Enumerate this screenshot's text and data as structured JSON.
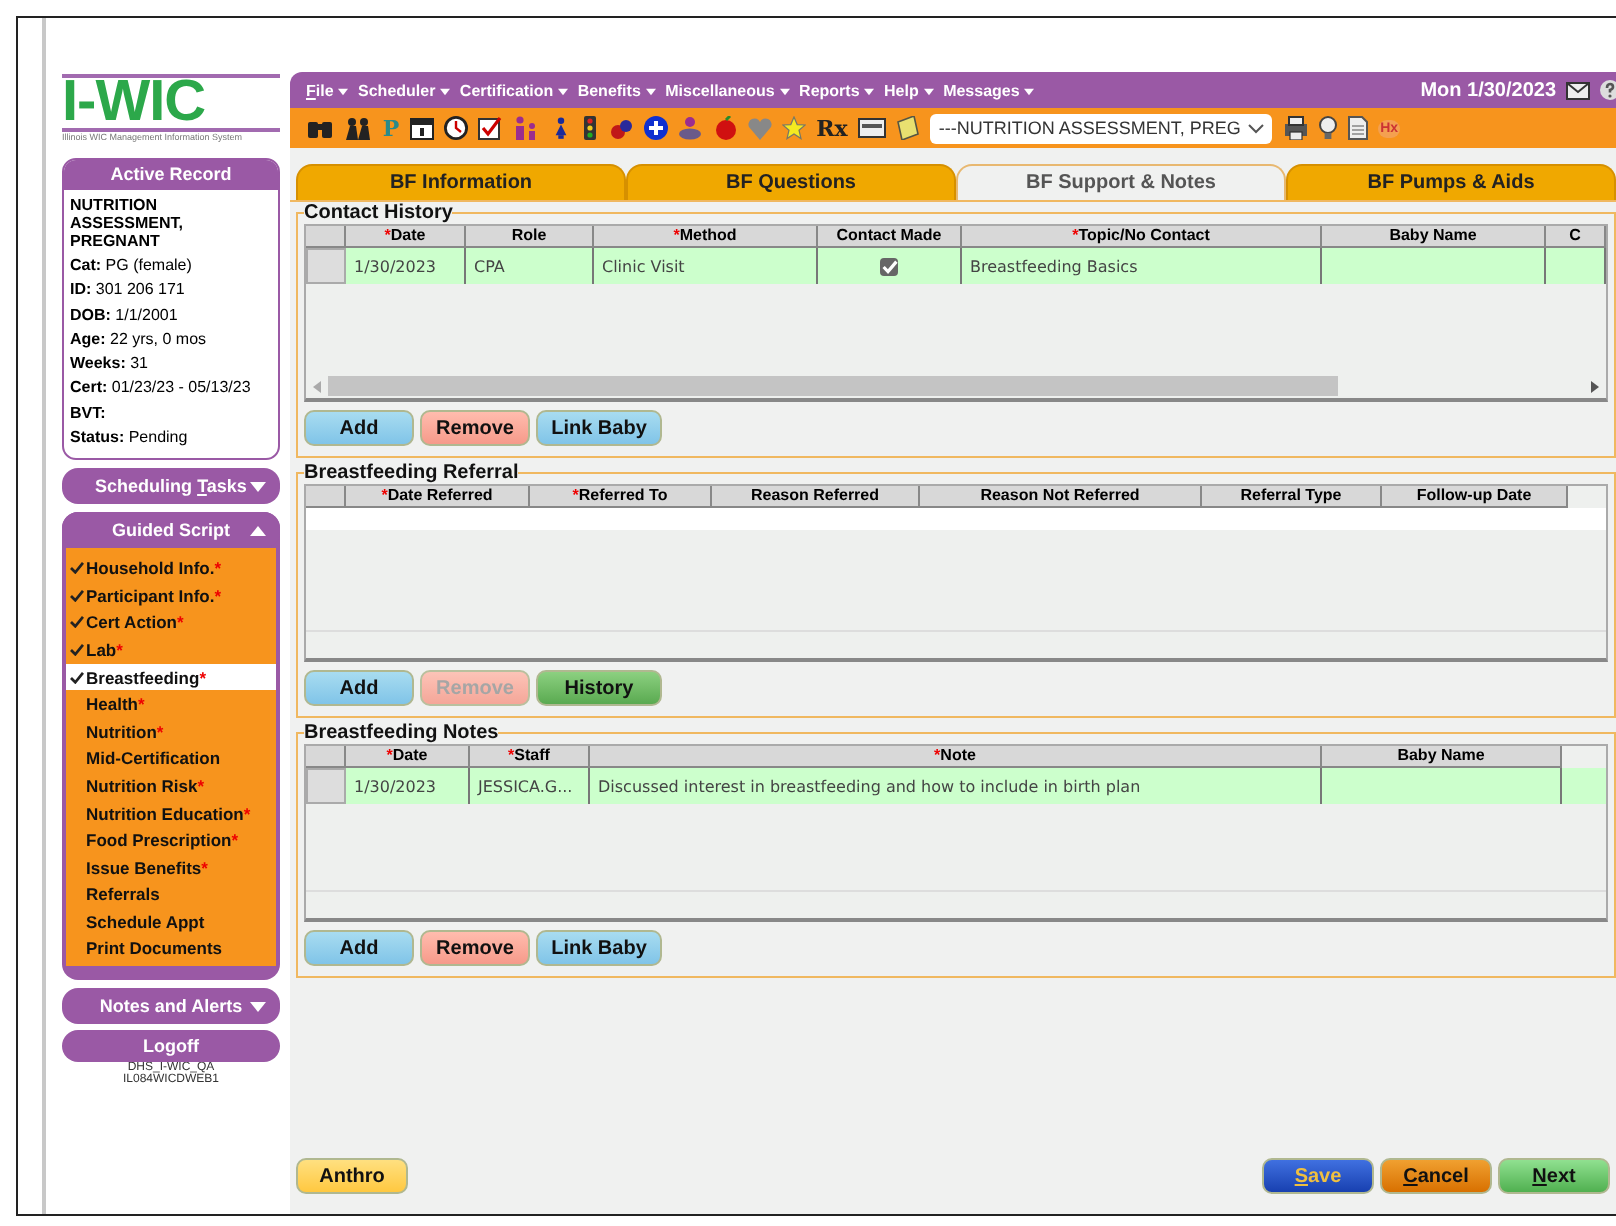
{
  "logo": {
    "title": "I-WIC",
    "subtitle": "Illinois WIC Management Information System"
  },
  "active_record": {
    "title": "Active Record",
    "heading": "NUTRITION ASSESSMENT, PREGNANT",
    "fields": [
      {
        "label": "Cat:",
        "value": "PG (female)"
      },
      {
        "label": "ID:",
        "value": "301 206 171"
      },
      {
        "label": "DOB:",
        "value": "1/1/2001"
      },
      {
        "label": "Age:",
        "value": "22 yrs, 0 mos"
      },
      {
        "label": "Weeks:",
        "value": "31"
      },
      {
        "label": "Cert:",
        "value": "01/23/23 - 05/13/23"
      },
      {
        "label": "BVT:"
      },
      {
        "label": "Status:",
        "value": "Pending"
      }
    ]
  },
  "scheduling_tasks": {
    "pre": "Scheduling ",
    "hot": "T",
    "rest": "asks",
    "expanded": false
  },
  "guided_script": {
    "title": "Guided Script",
    "expanded": true,
    "items": [
      {
        "label": "Household Info.",
        "done": true,
        "req": "*",
        "selected": false
      },
      {
        "label": "Participant Info.",
        "done": true,
        "req": "*",
        "selected": false
      },
      {
        "label": "Cert Action",
        "done": true,
        "req": "*",
        "selected": false
      },
      {
        "label": "Lab",
        "done": true,
        "req": "*",
        "selected": false
      },
      {
        "label": "Breastfeeding",
        "done": true,
        "req": "*",
        "selected": true
      },
      {
        "label": "Health",
        "done": false,
        "req": "*",
        "selected": false
      },
      {
        "label": "Nutrition",
        "done": false,
        "req": "*",
        "selected": false
      },
      {
        "label": "Mid-Certification",
        "done": false,
        "selected": false
      },
      {
        "label": "Nutrition Risk",
        "done": false,
        "req": "*",
        "selected": false
      },
      {
        "label": "Nutrition Education",
        "done": false,
        "req": "*",
        "selected": false
      },
      {
        "label": "Food Prescription",
        "done": false,
        "req": "*",
        "selected": false
      },
      {
        "label": "Issue Benefits",
        "done": false,
        "req": "*",
        "selected": false
      },
      {
        "label": "Referrals",
        "done": false,
        "selected": false
      },
      {
        "label": "Schedule Appt",
        "done": false,
        "selected": false
      },
      {
        "label": "Print Documents",
        "done": false,
        "selected": false
      }
    ]
  },
  "notes_and_alerts": {
    "title": "Notes and Alerts",
    "expanded": false
  },
  "logoff": "Logoff",
  "server": [
    "DHS_I-WIC_QA",
    "IL084WICDWEB1"
  ],
  "menu": [
    {
      "hot": "F",
      "rest": "ile"
    },
    {
      "rest": "Scheduler"
    },
    {
      "rest": "Certification"
    },
    {
      "rest": "Benefits"
    },
    {
      "rest": "Miscellaneous"
    },
    {
      "rest": "Reports"
    },
    {
      "rest": "Help"
    },
    {
      "rest": "Messages"
    }
  ],
  "date": "Mon 1/30/2023",
  "toolbar": [
    {
      "kind": "binoculars"
    },
    {
      "kind": "people"
    },
    {
      "kind": "letter",
      "text": "P"
    },
    {
      "kind": "calendar"
    },
    {
      "kind": "clock"
    },
    {
      "kind": "checkbox"
    },
    {
      "kind": "family"
    },
    {
      "kind": "woman"
    },
    {
      "kind": "traffic"
    },
    {
      "kind": "drops"
    },
    {
      "kind": "plus"
    },
    {
      "kind": "baby"
    },
    {
      "kind": "apple"
    },
    {
      "kind": "heart"
    },
    {
      "kind": "star"
    },
    {
      "kind": "letter",
      "text": "Rx"
    },
    {
      "kind": "card"
    },
    {
      "kind": "note"
    }
  ],
  "record_select": "---NUTRITION ASSESSMENT, PREG",
  "toolbar_right": [
    {
      "kind": "printer"
    },
    {
      "kind": "bulb"
    },
    {
      "kind": "document"
    },
    {
      "kind": "badge",
      "text": "Hx"
    }
  ],
  "tabs": [
    {
      "label": "BF Information",
      "selected": false
    },
    {
      "label": "BF Questions",
      "selected": false
    },
    {
      "label": "BF Support & Notes",
      "selected": true
    },
    {
      "label": "BF Pumps & Aids",
      "selected": false
    }
  ],
  "sections": [
    {
      "title": "Contact History",
      "scrollbar": true,
      "columns": [
        {
          "label": "Date",
          "req": "*"
        },
        {
          "label": "Role"
        },
        {
          "label": "Method",
          "req": "*"
        },
        {
          "label": "Contact Made"
        },
        {
          "label": "Topic/No Contact",
          "req": "*"
        },
        {
          "label": "Baby Name"
        },
        {
          "label": "C"
        }
      ],
      "rows": [
        {
          "cells": [
            {
              "kind": "text",
              "text": "1/30/2023"
            },
            {
              "kind": "text",
              "text": "CPA"
            },
            {
              "kind": "text",
              "text": "Clinic Visit"
            },
            {
              "kind": "check",
              "checked": true
            },
            {
              "kind": "text",
              "text": "Breastfeeding Basics"
            },
            {
              "kind": "blank"
            },
            {
              "kind": "blank"
            }
          ]
        }
      ],
      "buttons": [
        {
          "label": "Add",
          "kind": "blue",
          "disabled": false
        },
        {
          "label": "Remove",
          "kind": "red",
          "disabled": false
        },
        {
          "label": "Link Baby",
          "kind": "blue",
          "disabled": false
        }
      ]
    },
    {
      "title": "Breastfeeding Referral",
      "scrollbar": false,
      "columns": [
        {
          "label": "Date Referred",
          "req": "*"
        },
        {
          "label": "Referred To",
          "req": "*"
        },
        {
          "label": "Reason Referred"
        },
        {
          "label": "Reason Not Referred"
        },
        {
          "label": "Referral Type"
        },
        {
          "label": "Follow-up Date"
        }
      ],
      "buttons": [
        {
          "label": "Add",
          "kind": "blue",
          "disabled": false
        },
        {
          "label": "Remove",
          "kind": "red",
          "disabled": true
        },
        {
          "label": "History",
          "kind": "green",
          "disabled": false
        }
      ]
    },
    {
      "title": "Breastfeeding Notes",
      "scrollbar": false,
      "columns": [
        {
          "label": "Date",
          "req": "*"
        },
        {
          "label": "Staff",
          "req": "*"
        },
        {
          "label": "Note",
          "req": "*"
        },
        {
          "label": "Baby Name"
        }
      ],
      "rows": [
        {
          "cells": [
            {
              "kind": "text",
              "text": "1/30/2023"
            },
            {
              "kind": "text",
              "text": "JESSICA.G..."
            },
            {
              "kind": "text",
              "text": "Discussed interest in breastfeeding and how to include in birth plan"
            },
            {
              "kind": "blank"
            }
          ]
        }
      ],
      "buttons": [
        {
          "label": "Add",
          "kind": "blue",
          "disabled": false
        },
        {
          "label": "Remove",
          "kind": "red",
          "disabled": false
        },
        {
          "label": "Link Baby",
          "kind": "blue",
          "disabled": false
        }
      ]
    }
  ],
  "footer_left": [
    {
      "rest": "Anthro",
      "kind": "yellow"
    }
  ],
  "footer_right": [
    {
      "hot": "S",
      "rest": "ave",
      "kind": "navy"
    },
    {
      "hot": "C",
      "rest": "ancel",
      "kind": "orange"
    },
    {
      "hot": "N",
      "rest": "ext",
      "kind": "green"
    }
  ]
}
